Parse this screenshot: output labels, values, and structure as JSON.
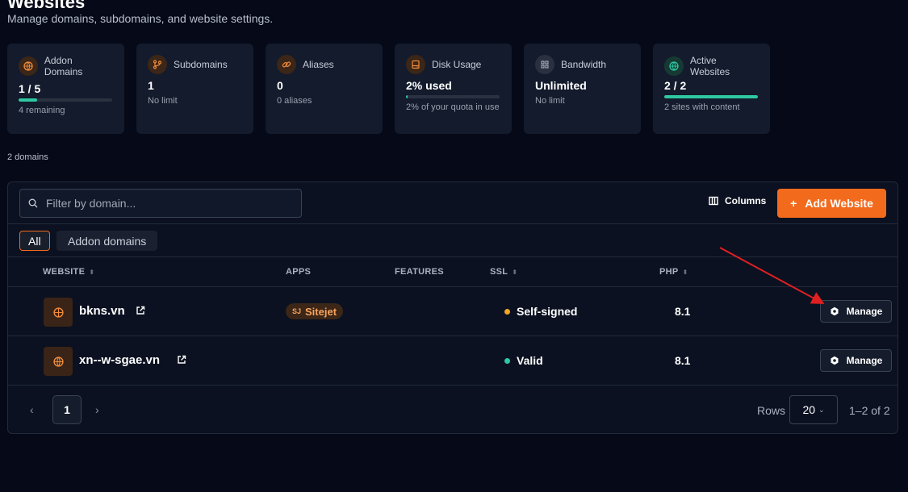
{
  "page": {
    "title": "Websites",
    "subtitle": "Manage domains, subdomains, and website settings."
  },
  "stats": [
    {
      "label": "Addon Domains",
      "value": "1 / 5",
      "note": "4 remaining",
      "icon": "globe-icon",
      "progress": 0.2
    },
    {
      "label": "Subdomains",
      "value": "1",
      "note": "No limit",
      "icon": "branch-icon"
    },
    {
      "label": "Aliases",
      "value": "0",
      "note": "0 aliases",
      "icon": "link-icon"
    },
    {
      "label": "Disk Usage",
      "value": "2% used",
      "note": "2% of your quota in use",
      "icon": "disk-icon",
      "progress": 0.02
    },
    {
      "label": "Bandwidth",
      "value": "Unlimited",
      "note": "No limit",
      "icon": "grid-icon"
    },
    {
      "label": "Active Websites",
      "value": "2 / 2",
      "note": "2 sites with content",
      "icon": "globe-icon",
      "progress": 1.0
    }
  ],
  "domains_count": "2 domains",
  "toolbar": {
    "search_placeholder": "Filter by domain...",
    "columns_label": "Columns",
    "add_label": "Add Website"
  },
  "filters": [
    "All",
    "Addon domains"
  ],
  "table": {
    "headers": {
      "website": "WEBSITE",
      "apps": "APPS",
      "features": "FEATURES",
      "ssl": "SSL",
      "php": "PHP"
    },
    "rows": [
      {
        "site": "bkns.vn",
        "app": "Sitejet",
        "app_icon_text": "SJ",
        "ssl": "Self-signed",
        "ssl_color": "#f5a623",
        "php": "8.1",
        "action": "Manage"
      },
      {
        "site": "xn--w-sgae.vn",
        "app": "",
        "app_icon_text": "",
        "ssl": "Valid",
        "ssl_color": "#2fc8a3",
        "php": "8.1",
        "action": "Manage"
      }
    ]
  },
  "pagination": {
    "current_page": "1",
    "rows_label": "Rows",
    "rows_value": "20",
    "range": "1–2 of 2"
  },
  "colors": {
    "accent": "#f26b1d",
    "success": "#2fc8a3",
    "warning": "#f5a623",
    "annotation": "#e02020"
  }
}
